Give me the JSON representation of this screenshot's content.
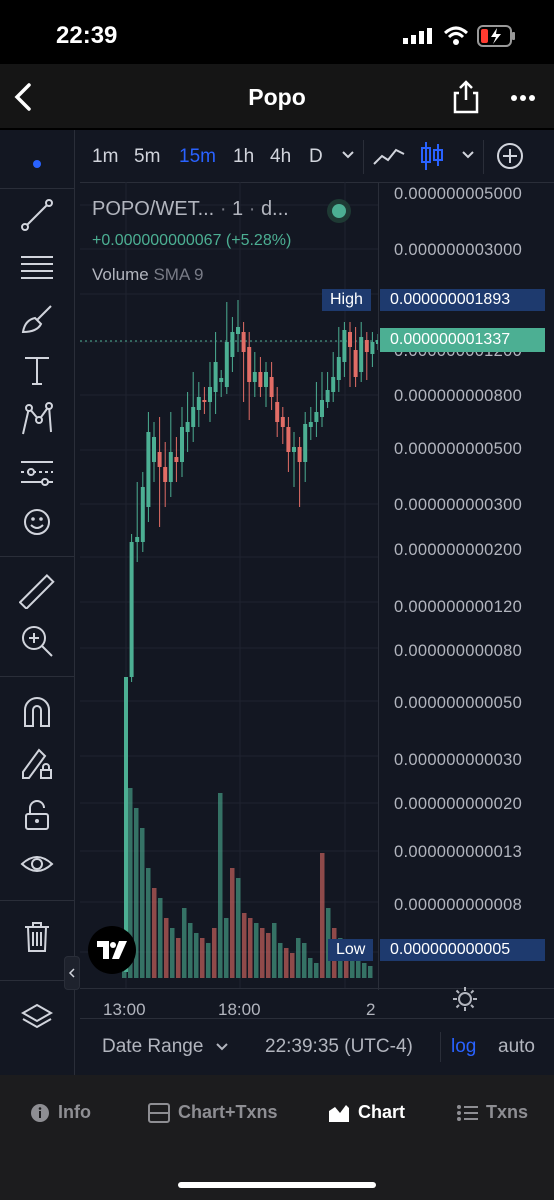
{
  "status_bar": {
    "time": "22:39"
  },
  "header": {
    "title": "Popo",
    "back_icon": "chevron-left-icon",
    "share_icon": "share-icon",
    "more_icon": "more-horizontal-icon"
  },
  "toolbar": {
    "timeframes": [
      "1m",
      "5m",
      "15m",
      "1h",
      "4h",
      "D"
    ],
    "active_timeframe": "15m",
    "chart_style_icons": [
      "line-chart-icon",
      "candlestick-icon",
      "add-indicator-icon"
    ]
  },
  "legend": {
    "symbol": "POPO/WET...",
    "interval": "1",
    "source": "d...",
    "change": "+0.000000000067 (+5.28%)",
    "volume_label": "Volume",
    "volume_sma": "SMA 9"
  },
  "price_axis": {
    "labels": [
      "0.000000005000",
      "0.000000003000",
      "0.000000001200",
      "0.000000000800",
      "0.000000000500",
      "0.000000000300",
      "0.000000000200",
      "0.000000000120",
      "0.000000000080",
      "0.000000000050",
      "0.000000000030",
      "0.000000000020",
      "0.000000000013",
      "0.000000000008"
    ],
    "high_label": "High",
    "high_value": "0.000000001893",
    "current_value": "0.000000001337",
    "low_label": "Low",
    "low_value": "0.000000000005"
  },
  "time_axis": {
    "labels": [
      "13:00",
      "18:00",
      "2"
    ]
  },
  "bottom_bar": {
    "date_range": "Date Range",
    "clock": "22:39:35 (UTC-4)",
    "log": "log",
    "auto": "auto"
  },
  "tabs": [
    {
      "label": "Info",
      "icon": "info-icon"
    },
    {
      "label": "Chart+Txns",
      "icon": "split-view-icon"
    },
    {
      "label": "Chart",
      "icon": "area-chart-icon",
      "active": true
    },
    {
      "label": "Txns",
      "icon": "list-icon"
    }
  ],
  "colors": {
    "up": "#4caf93",
    "down": "#e26d66",
    "accent": "#2962ff",
    "background": "#131722"
  }
}
